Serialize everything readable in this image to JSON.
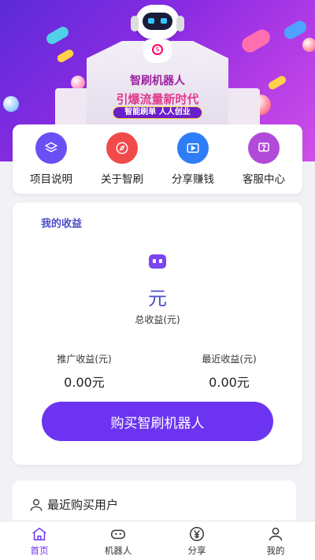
{
  "banner": {
    "title": "智刷机器人",
    "slogan": "引爆流量新时代",
    "tagline": "智能刷单 人人创业"
  },
  "quick_menu": [
    {
      "label": "项目说明",
      "icon": "layers-icon",
      "color": "#6a4ff5"
    },
    {
      "label": "关于智刷",
      "icon": "compass-icon",
      "color": "#f04a4a"
    },
    {
      "label": "分享赚钱",
      "icon": "video-icon",
      "color": "#2f7df6"
    },
    {
      "label": "客服中心",
      "icon": "help-chat-icon",
      "color": "#b24ad9"
    }
  ],
  "earnings": {
    "title": "我的收益",
    "unit": "元",
    "total_label": "总收益(元)",
    "promo_label": "推广收益(元)",
    "promo_value": "0.00元",
    "recent_label": "最近收益(元)",
    "recent_value": "0.00元",
    "buy_button": "购买智刷机器人"
  },
  "recent_buyers": {
    "title": "最近购买用户"
  },
  "tabbar": [
    {
      "label": "首页",
      "icon": "home-icon",
      "active": true
    },
    {
      "label": "机器人",
      "icon": "robot-icon",
      "active": false
    },
    {
      "label": "分享",
      "icon": "yen-icon",
      "active": false
    },
    {
      "label": "我的",
      "icon": "user-icon",
      "active": false
    }
  ],
  "colors": {
    "accent": "#6c34f0",
    "title_blue": "#4b4fc9",
    "banner_start": "#5b2bd8",
    "banner_end": "#d04fe8"
  }
}
